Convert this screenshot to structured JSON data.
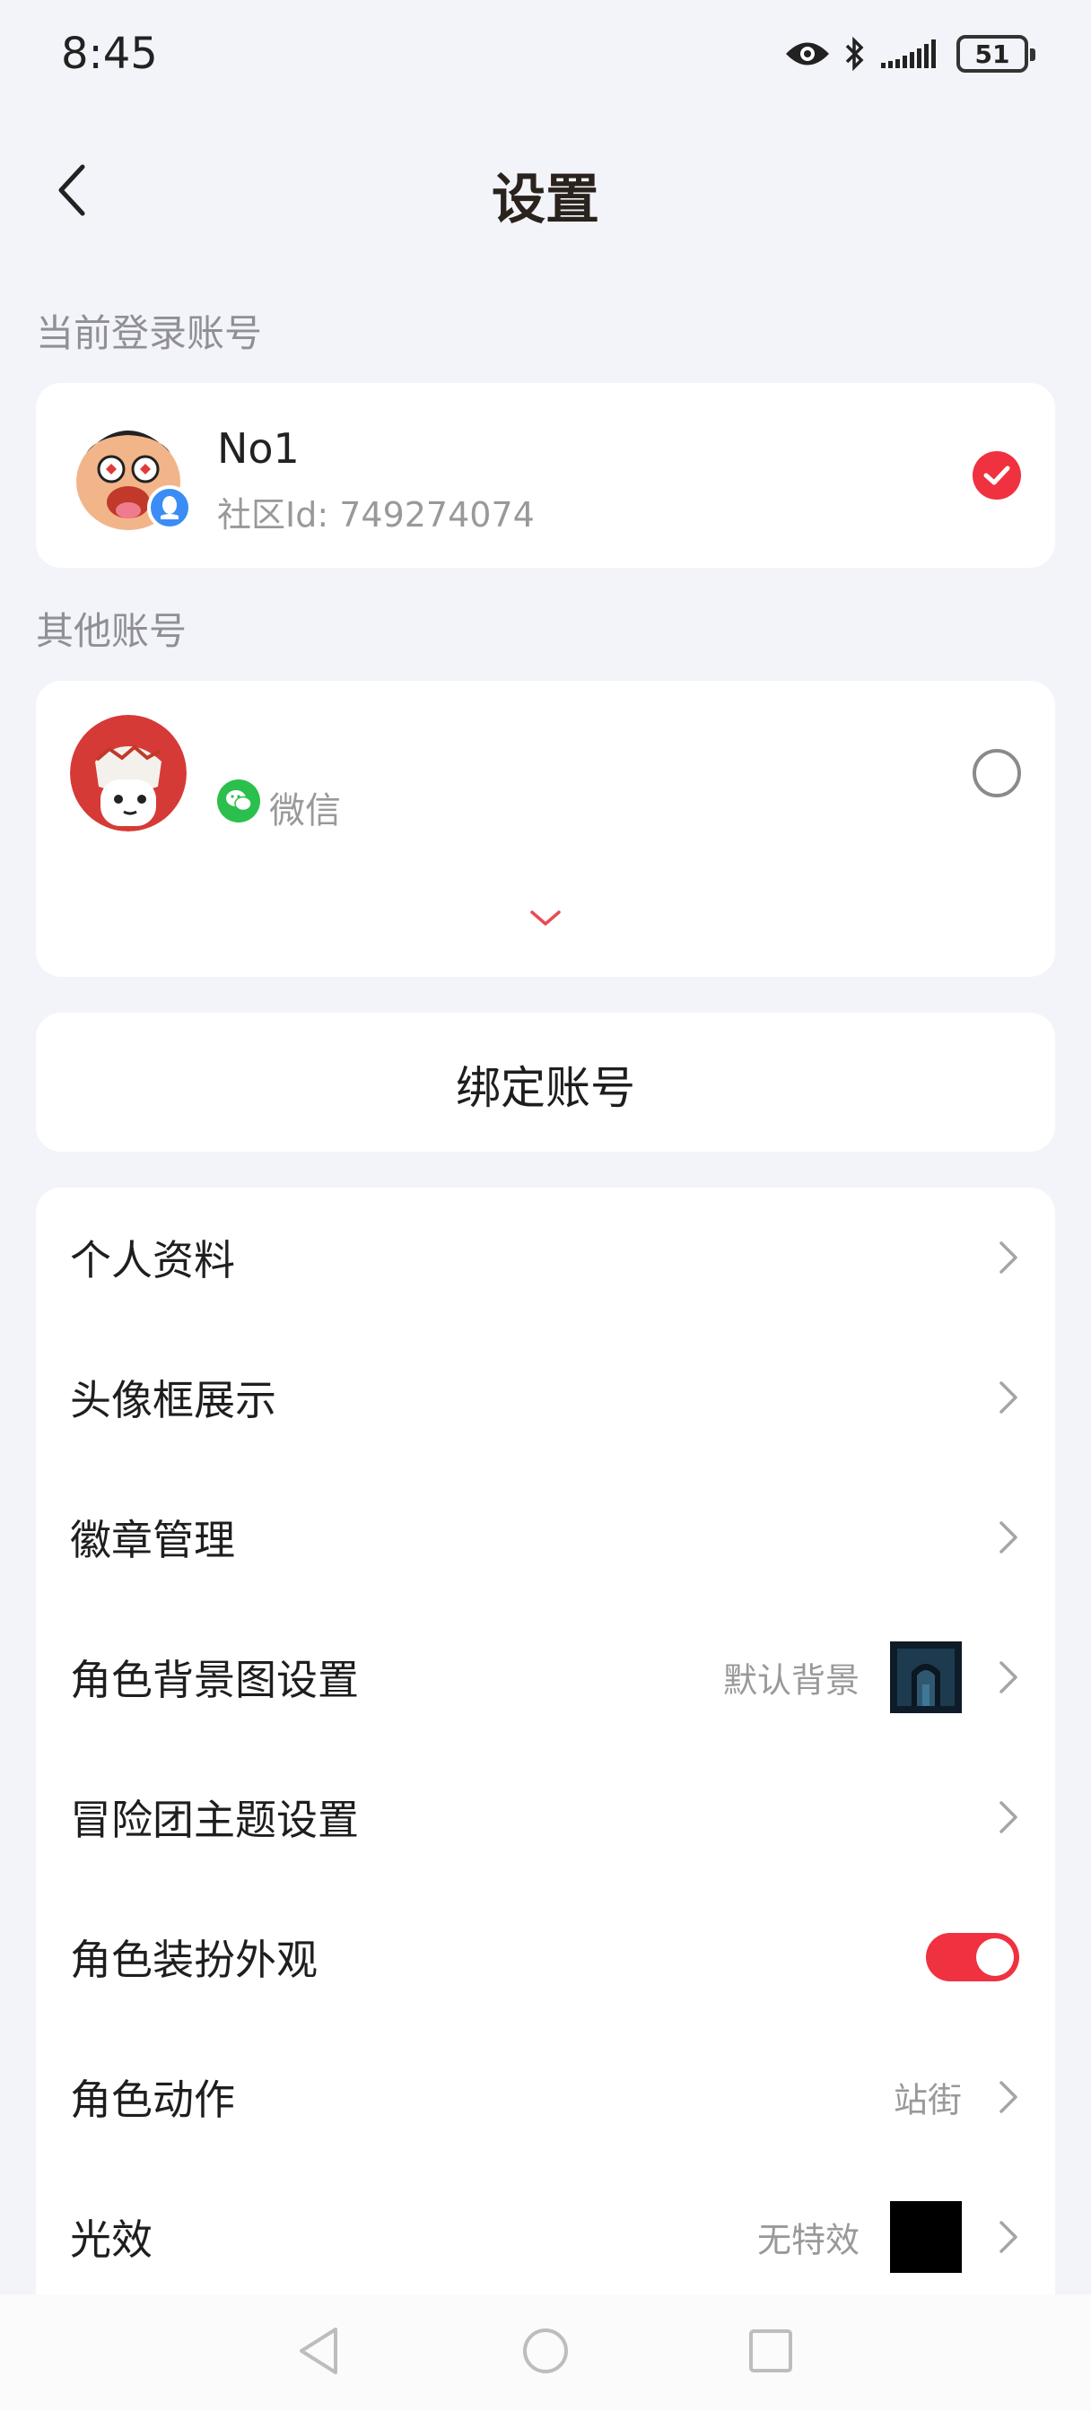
{
  "status_bar": {
    "time": "8:45",
    "battery": "51",
    "icons": [
      "eye-icon",
      "bluetooth-icon",
      "signal-icon",
      "battery-icon"
    ]
  },
  "header": {
    "title": "设置",
    "back_icon": "back-arrow-icon"
  },
  "current_account": {
    "section_label": "当前登录账号",
    "name": "No1",
    "id_text": "社区Id: 749274074",
    "selected": true,
    "platform_badge": "qq-icon"
  },
  "other_accounts": {
    "section_label": "其他账号",
    "items": [
      {
        "name": "",
        "platform": "微信",
        "platform_icon": "wechat-icon",
        "selected": false
      }
    ],
    "expand_icon": "chevron-down-icon"
  },
  "bind_account": {
    "label": "绑定账号"
  },
  "menu": {
    "items": [
      {
        "label": "个人资料"
      },
      {
        "label": "头像框展示"
      },
      {
        "label": "徽章管理"
      },
      {
        "label": "角色背景图设置",
        "value": "默认背景"
      },
      {
        "label": "冒险团主题设置"
      },
      {
        "label": "角色装扮外观",
        "toggle": true
      },
      {
        "label": "角色动作",
        "value": "站街"
      },
      {
        "label": "光效",
        "value": "无特效"
      }
    ]
  },
  "colors": {
    "accent": "#f0313f",
    "background": "#f3f4f9",
    "card": "#ffffff",
    "wechat": "#2bbf4d",
    "qq_badge": "#3b8cf5"
  },
  "nav_bar": {
    "icons": [
      "nav-back-icon",
      "nav-home-icon",
      "nav-recents-icon"
    ]
  }
}
